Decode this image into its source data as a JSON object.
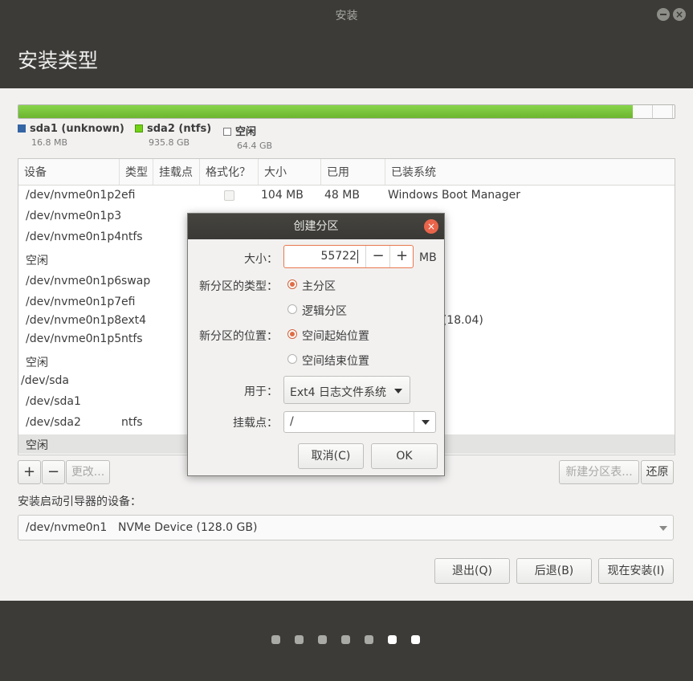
{
  "window": {
    "title": "安装"
  },
  "page": {
    "title": "安装类型"
  },
  "legend": [
    {
      "name": "sda1 (unknown)",
      "size": "16.8 MB",
      "color": "#3465a4"
    },
    {
      "name": "sda2 (ntfs)",
      "size": "935.8 GB",
      "color": "#73d216"
    },
    {
      "name": "空闲",
      "size": "64.4 GB",
      "color": "#ffffff"
    }
  ],
  "table": {
    "headers": [
      "设备",
      "类型",
      "挂载点",
      "格式化？",
      "大小",
      "已用",
      "已装系统"
    ],
    "rows": [
      {
        "device": "/dev/nvme0n1p2",
        "type": "efi",
        "mount": "",
        "format_checkbox": true,
        "size": "104 MB",
        "used": "48 MB",
        "system": "Windows Boot Manager"
      },
      {
        "device": "/dev/nvme0n1p3",
        "type": "",
        "mount": "",
        "size": "",
        "used": "",
        "system": ""
      },
      {
        "device": "/dev/nvme0n1p4",
        "type": "ntfs",
        "mount": "",
        "size": "",
        "used": "",
        "system": ""
      },
      {
        "device": "空闲",
        "type": "",
        "mount": "",
        "size": "",
        "used": "",
        "system": ""
      },
      {
        "device": "/dev/nvme0n1p6",
        "type": "swap",
        "mount": "",
        "size": "",
        "used": "",
        "system": ""
      },
      {
        "device": "/dev/nvme0n1p7",
        "type": "efi",
        "mount": "",
        "size": "",
        "used": "",
        "system": ""
      },
      {
        "device": "/dev/nvme0n1p8",
        "type": "ext4",
        "mount": "",
        "size": "",
        "used": "",
        "system": ".04.1 LTS (18.04)"
      },
      {
        "device": "/dev/nvme0n1p5",
        "type": "ntfs",
        "mount": "",
        "size": "",
        "used": "",
        "system": ""
      },
      {
        "device": "空闲",
        "type": "",
        "mount": "",
        "size": "",
        "used": "",
        "system": ""
      },
      {
        "device": "/dev/sda",
        "type": "",
        "mount": "",
        "size": "",
        "used": "",
        "system": ""
      },
      {
        "device": "/dev/sda1",
        "type": "",
        "mount": "",
        "size": "",
        "used": "",
        "system": ""
      },
      {
        "device": "/dev/sda2",
        "type": "ntfs",
        "mount": "",
        "size": "",
        "used": "",
        "system": ""
      },
      {
        "device": "空闲",
        "type": "",
        "mount": "",
        "size": "",
        "used": "",
        "system": "",
        "selected": true
      }
    ]
  },
  "table_buttons": {
    "add": "+",
    "remove": "−",
    "change": "更改...",
    "new_table": "新建分区表...",
    "revert": "还原"
  },
  "bootloader": {
    "label": "安装启动引导器的设备：",
    "device": "/dev/nvme0n1",
    "description": "NVMe Device (128.0 GB)"
  },
  "nav_buttons": {
    "quit": "退出(Q)",
    "back": "后退(B)",
    "install": "现在安装(I)"
  },
  "progress": {
    "total_steps": 7,
    "current_step": 6
  },
  "dialog": {
    "title": "创建分区",
    "size_label": "大小：",
    "size_value": "55722",
    "size_unit": "MB",
    "minus": "−",
    "plus": "+",
    "type_label": "新分区的类型：",
    "type_primary": "主分区",
    "type_logical": "逻辑分区",
    "type_selected": "primary",
    "location_label": "新分区的位置：",
    "location_start": "空间起始位置",
    "location_end": "空间结束位置",
    "location_selected": "start",
    "use_label": "用于：",
    "use_value": "Ext4 日志文件系统",
    "mount_label": "挂载点：",
    "mount_value": "/",
    "cancel": "取消(C)",
    "ok": "OK"
  }
}
